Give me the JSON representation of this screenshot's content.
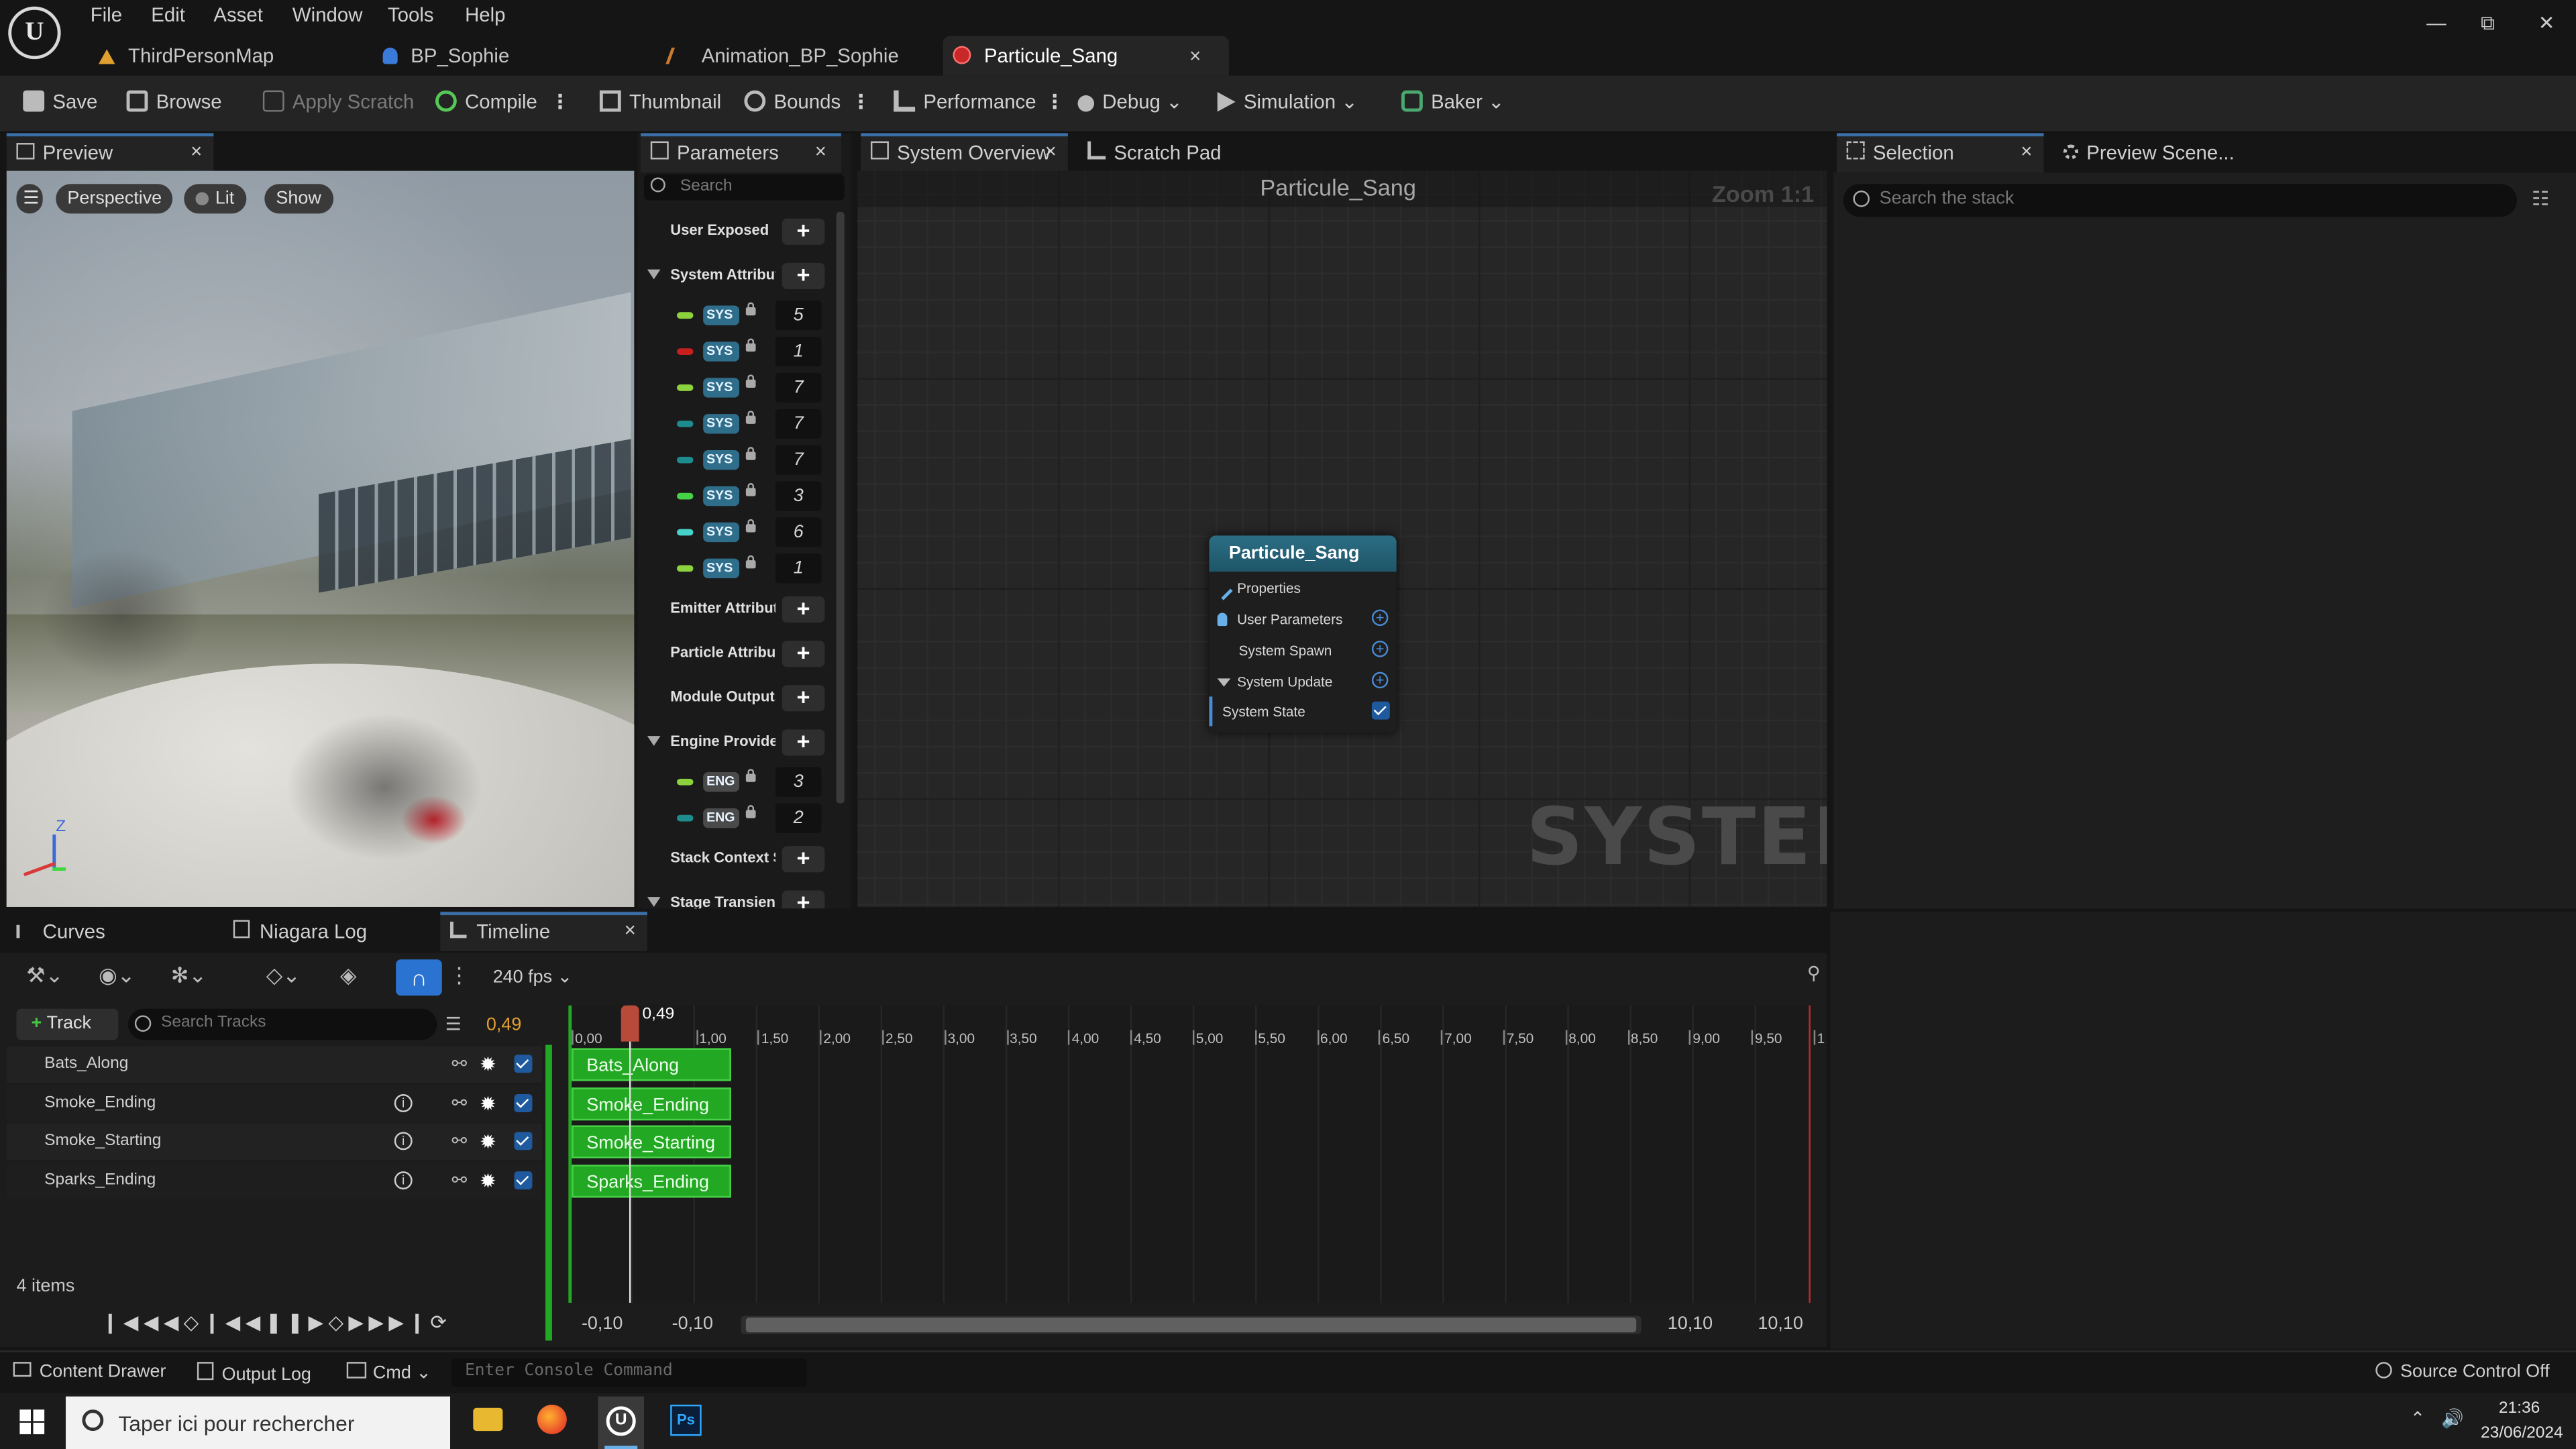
{
  "menu": {
    "items": [
      "File",
      "Edit",
      "Asset",
      "Window",
      "Tools",
      "Help"
    ]
  },
  "doc_tabs": [
    {
      "label": "ThirdPersonMap",
      "icon": "map-icon"
    },
    {
      "label": "BP_Sophie",
      "icon": "blueprint-icon"
    },
    {
      "label": "Animation_BP_Sophie",
      "icon": "anim-blueprint-icon"
    },
    {
      "label": "Particule_Sang",
      "icon": "niagara-system-icon",
      "close": "×"
    }
  ],
  "toolbar": {
    "save": "Save",
    "browse": "Browse",
    "apply_scratch": "Apply Scratch",
    "compile": "Compile",
    "thumbnail": "Thumbnail",
    "bounds": "Bounds",
    "performance": "Performance",
    "debug": "Debug",
    "simulation": "Simulation",
    "baker": "Baker"
  },
  "preview": {
    "tab": "Preview",
    "close": "×",
    "chips": {
      "perspective": "Perspective",
      "lit": "Lit",
      "show": "Show"
    },
    "axis": {
      "z": "Z"
    }
  },
  "parameters": {
    "tab": "Parameters",
    "close": "×",
    "search_placeholder": "Search",
    "user_exposed": "User Exposed",
    "system_attributes": "System Attribut",
    "system_rows": [
      {
        "badge": "SYS",
        "value": "5",
        "color": "#8cd23c"
      },
      {
        "badge": "SYS",
        "value": "1",
        "color": "#c81e1e"
      },
      {
        "badge": "SYS",
        "value": "7",
        "color": "#8cd23c"
      },
      {
        "badge": "SYS",
        "value": "7",
        "color": "#1e8c8c"
      },
      {
        "badge": "SYS",
        "value": "7",
        "color": "#1e8c8c"
      },
      {
        "badge": "SYS",
        "value": "3",
        "color": "#46d246"
      },
      {
        "badge": "SYS",
        "value": "6",
        "color": "#46d2c8"
      },
      {
        "badge": "SYS",
        "value": "1",
        "color": "#8cd23c"
      }
    ],
    "emitter_attributes": "Emitter Attribute",
    "particle_attributes": "Particle Attribut",
    "module_outputs": "Module Outputs",
    "engine_provided": "Engine Providec",
    "engine_rows": [
      {
        "badge": "ENG",
        "value": "3",
        "color": "#8cd23c"
      },
      {
        "badge": "ENG",
        "value": "2",
        "color": "#1e8c8c"
      }
    ],
    "stack_context": "Stack Context S",
    "stage_transient": "Stage Transient"
  },
  "graph": {
    "tabs": {
      "overview": "System Overview",
      "scratch": "Scratch Pad",
      "close": "×"
    },
    "title": "Particule_Sang",
    "zoom": "Zoom 1:1",
    "watermark": "SYSTEM",
    "node": {
      "title": "Particule_Sang",
      "properties": "Properties",
      "user_parameters": "User Parameters",
      "system_spawn": "System Spawn",
      "system_update": "System Update",
      "system_state": "System State"
    }
  },
  "selection": {
    "tab": "Selection",
    "close": "×",
    "preview_scene": "Preview Scene...",
    "search_placeholder": "Search the stack"
  },
  "timeline_tabs": {
    "curves": "Curves",
    "niagara_log": "Niagara Log",
    "timeline": "Timeline",
    "close": "×"
  },
  "timeline": {
    "fps": "240 fps",
    "track_button": "Track",
    "search_placeholder": "Search Tracks",
    "current_time": "0,49",
    "playhead_label": "0,49",
    "tracks": [
      "Bats_Along",
      "Smoke_Ending",
      "Smoke_Starting",
      "Sparks_Ending"
    ],
    "items_count": "4 items",
    "ruler": [
      "0,00",
      "1,00",
      "1,50",
      "2,00",
      "2,50",
      "3,00",
      "3,50",
      "4,00",
      "4,50",
      "5,00",
      "5,50",
      "6,00",
      "6,50",
      "7,00",
      "7,50",
      "8,00",
      "8,50",
      "9,00",
      "9,50",
      "1"
    ],
    "range": {
      "start1": "-0,10",
      "start2": "-0,10",
      "end1": "10,10",
      "end2": "10,10"
    }
  },
  "statusbar": {
    "content_drawer": "Content Drawer",
    "output_log": "Output Log",
    "cmd": "Cmd",
    "console_placeholder": "Enter Console Command",
    "source_control": "Source Control Off"
  },
  "taskbar": {
    "search_placeholder": "Taper ici pour rechercher",
    "time": "21:36",
    "date": "23/06/2024"
  }
}
